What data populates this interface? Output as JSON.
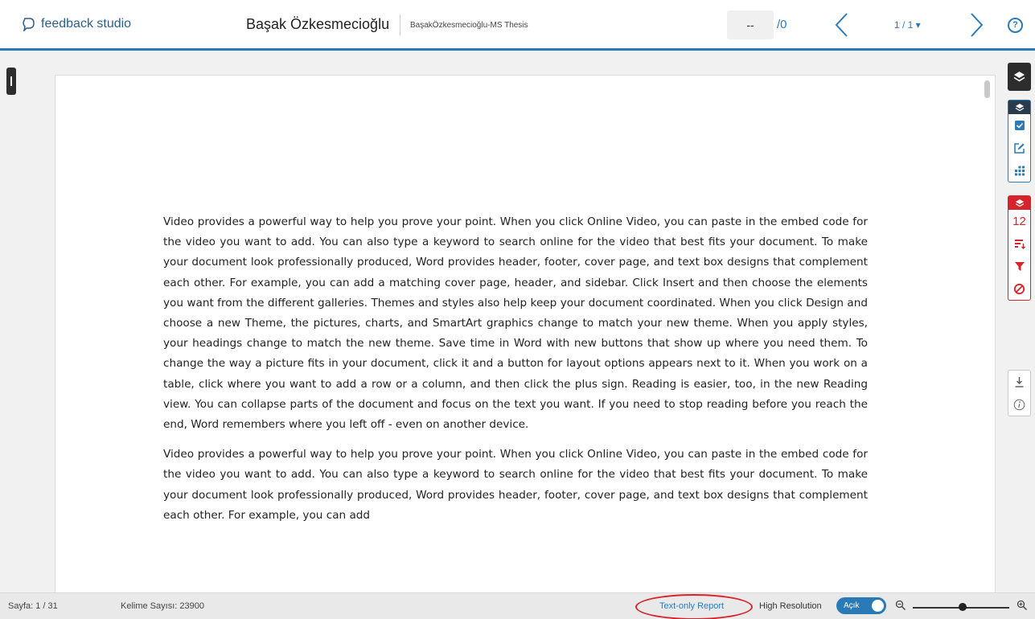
{
  "header": {
    "brand": "feedback studio",
    "student_name": "Başak Özkesmecioğlu",
    "paper_title": "BaşakÖzkesmecioğlu-MS Thesis",
    "page_input_value": "--",
    "page_total": "/0",
    "page_select": "1 / 1 ▾",
    "help_glyph": "?"
  },
  "document": {
    "paragraphs": [
      "Video provides a powerful way to help you prove your point. When you click Online Video, you can paste in the embed code for the video you want to add. You can also type a keyword to search online for the video that best fits your document. To make your document look professionally produced, Word provides header, footer, cover page, and text box designs that complement each other. For example, you can add a matching cover page, header, and sidebar. Click Insert and then choose the elements you want from the different galleries. Themes and styles also help keep your document coordinated. When you click Design and choose a new Theme, the pictures, charts, and SmartArt graphics change to match your new theme. When you apply styles, your headings change to match the new theme. Save time in Word with new buttons that show up where you need them. To change the way a picture fits in your document, click it and a button for layout options appears next to it. When you work on a table, click where you want to add a row or a column, and then click the plus sign. Reading is easier, too, in the new Reading view. You can collapse parts of the document and focus on the text you want. If you need to stop reading before you reach the end, Word remembers where you left off - even on another device.",
      "Video provides a powerful way to help you prove your point. When you click Online Video, you can paste in the embed code for the video you want to add. You can also type a keyword to search online for the video that best fits your document. To make your document look professionally produced, Word provides header, footer, cover page, and text box designs that complement each other. For example, you can add"
    ]
  },
  "rail": {
    "similarity_score": "12",
    "icons": [
      "layers-icon",
      "layers-icon",
      "checkbox-icon",
      "edit-icon",
      "grid-icon",
      "layers-icon",
      "sort-icon",
      "filter-icon",
      "exclude-icon",
      "download-icon",
      "info-icon"
    ]
  },
  "statusbar": {
    "page_label": "Sayfa: 1 / 31",
    "word_count": "Kelime Sayısı: 23900",
    "text_only_report": "Text-only Report",
    "high_resolution": "High Resolution",
    "toggle_state": "Açık"
  },
  "colors": {
    "accent_blue": "#2a7ab8",
    "similarity_red": "#d6242a",
    "rail_dark": "#2d2d2d"
  }
}
